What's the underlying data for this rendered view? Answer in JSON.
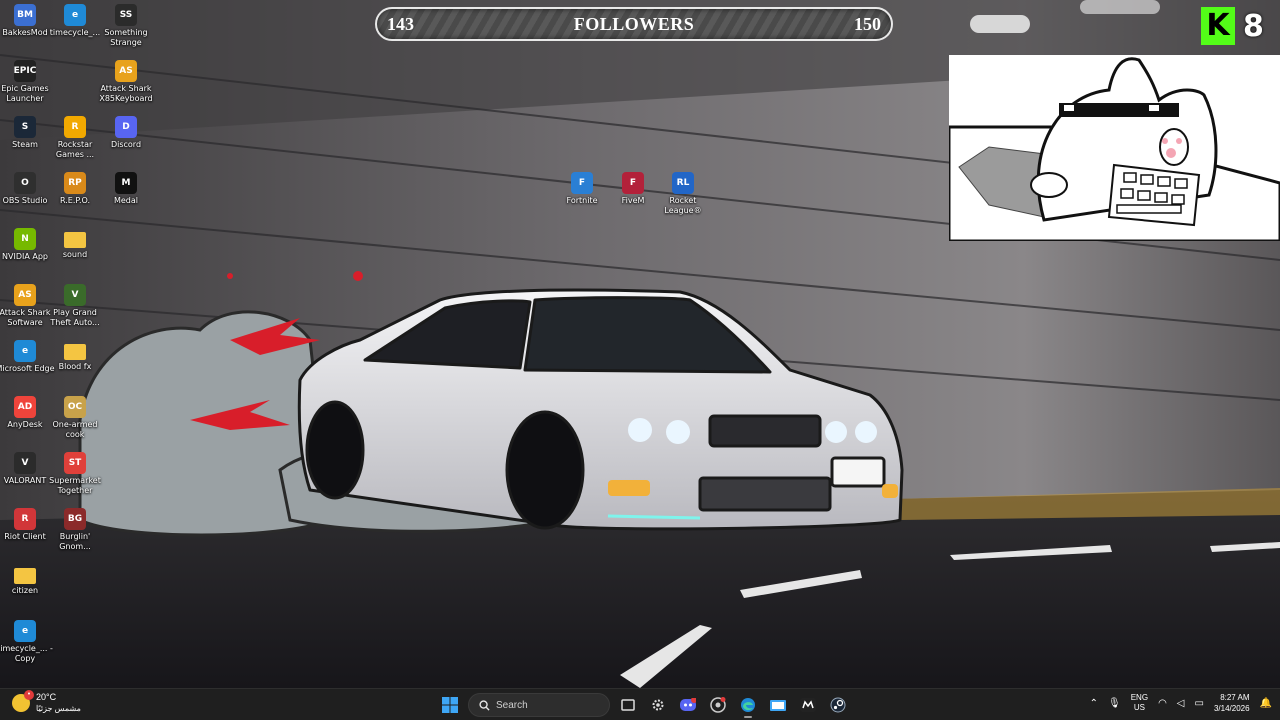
{
  "desktop": {
    "icons": [
      {
        "label": "BakkesMod",
        "abbr": "BM",
        "color": "#3b6fd1"
      },
      {
        "label": "timecycle_...",
        "abbr": "e",
        "color": "#1f8ad6"
      },
      {
        "label": "Something Strange",
        "abbr": "SS",
        "color": "#2b2b2b"
      },
      {
        "label": "Epic Games Launcher",
        "abbr": "EPIC",
        "color": "#222222"
      },
      {
        "label": "Attack Shark X85Keyboard",
        "abbr": "AS",
        "color": "#e8a21c"
      },
      {
        "label": "Steam",
        "abbr": "S",
        "color": "#1b2838"
      },
      {
        "label": "Rockstar Games ...",
        "abbr": "R",
        "color": "#f2a900"
      },
      {
        "label": "Discord",
        "abbr": "D",
        "color": "#5865f2"
      },
      {
        "label": "OBS Studio",
        "abbr": "O",
        "color": "#2f2f2f"
      },
      {
        "label": "R.E.P.O.",
        "abbr": "RP",
        "color": "#d98a1a"
      },
      {
        "label": "Medal",
        "abbr": "M",
        "color": "#111111"
      },
      {
        "label": "NVIDIA App",
        "abbr": "N",
        "color": "#76b900"
      },
      {
        "label": "sound",
        "abbr": "",
        "color": "#f4c542"
      },
      {
        "label": "Attack Shark Software",
        "abbr": "AS",
        "color": "#e8a21c"
      },
      {
        "label": "Play Grand Theft Auto...",
        "abbr": "V",
        "color": "#3a6b2a"
      },
      {
        "label": "Microsoft Edge",
        "abbr": "e",
        "color": "#1f8ad6"
      },
      {
        "label": "Blood fx",
        "abbr": "",
        "color": "#f4c542"
      },
      {
        "label": "AnyDesk",
        "abbr": "AD",
        "color": "#ef443b"
      },
      {
        "label": "One-armed cook",
        "abbr": "OC",
        "color": "#c8a24a"
      },
      {
        "label": "VALORANT",
        "abbr": "V",
        "color": "#2b2b2b"
      },
      {
        "label": "Supermarket Together",
        "abbr": "ST",
        "color": "#e0403a"
      },
      {
        "label": "Riot Client",
        "abbr": "R",
        "color": "#d13639"
      },
      {
        "label": "Burglin' Gnom...",
        "abbr": "BG",
        "color": "#8b2a2a"
      },
      {
        "label": "citizen",
        "abbr": "",
        "color": "#f4c542"
      },
      {
        "label": "timecycle_... - Copy",
        "abbr": "e",
        "color": "#1f8ad6"
      },
      {
        "label": "Fortnite",
        "abbr": "F",
        "color": "#2a7fd4"
      },
      {
        "label": "FiveM",
        "abbr": "F",
        "color": "#b3213a"
      },
      {
        "label": "Rocket League®",
        "abbr": "RL",
        "color": "#2266c7"
      }
    ]
  },
  "overlay": {
    "followers": {
      "current": "143",
      "label": "FOLLOWERS",
      "goal": "150"
    },
    "kick": {
      "logo": "K",
      "count": "8",
      "color": "#53fc18"
    }
  },
  "taskbar": {
    "weather": {
      "temp": "20°C",
      "desc": "مشمس جزئيًا"
    },
    "search_placeholder": "Search",
    "apps": [
      "start",
      "search",
      "task-view",
      "settings",
      "discord",
      "chrome",
      "edge",
      "file-explorer",
      "medal",
      "steam"
    ],
    "tray": {
      "lang_top": "ENG",
      "lang_bottom": "US",
      "time": "8:27 AM",
      "date": "3/14/2026"
    }
  }
}
